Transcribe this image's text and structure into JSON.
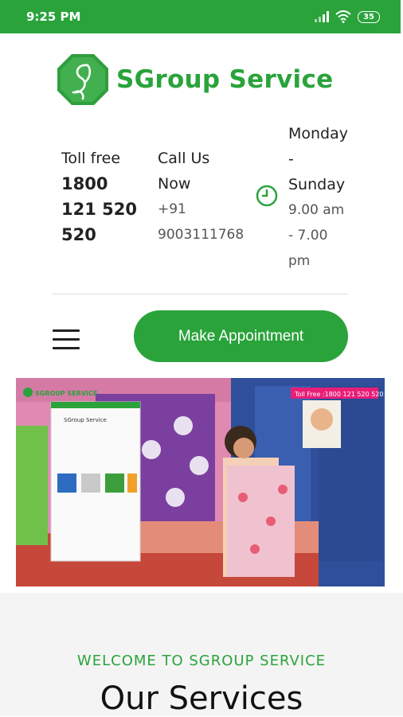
{
  "status_bar": {
    "time": "9:25 PM",
    "battery": "35"
  },
  "brand": {
    "name": "SGroup Service",
    "color": "#2aa33b"
  },
  "contact": {
    "tollfree": {
      "label": "Toll free",
      "number_lines": [
        "1800",
        "121 520",
        "520"
      ]
    },
    "call": {
      "label_lines": [
        "Call Us",
        "Now"
      ],
      "phone_lines": [
        "+91",
        "9003111768"
      ]
    },
    "hours": {
      "days_lines": [
        "Monday",
        "-",
        "Sunday"
      ],
      "time_lines": [
        "9.00 am",
        "- 7.00",
        "pm"
      ]
    }
  },
  "actions": {
    "appointment_label": "Make Appointment"
  },
  "video": {
    "overlay_logo": "SGROUP SERVICE",
    "tollfree_banner": "Toll Free :1800 121 520 520",
    "phone_mock_title": "SGroup Service"
  },
  "welcome": {
    "kicker": "WELCOME TO SGROUP SERVICE",
    "title": "Our Services"
  },
  "icons": [
    "signal-icon",
    "wifi-icon",
    "battery-icon",
    "logo-icon",
    "clock-icon",
    "menu-icon"
  ]
}
